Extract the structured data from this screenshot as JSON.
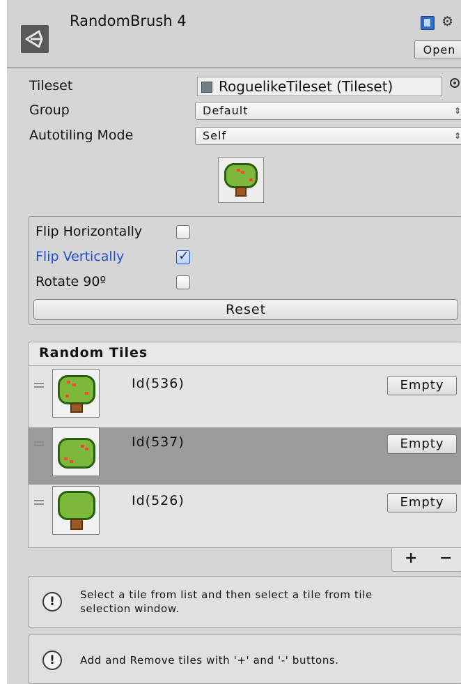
{
  "header": {
    "title": "RandomBrush 4",
    "open_label": "Open"
  },
  "properties": {
    "tileset_label": "Tileset",
    "tileset_value": "RoguelikeTileset (Tileset)",
    "group_label": "Group",
    "group_value": "Default",
    "autotiling_label": "Autotiling Mode",
    "autotiling_value": "Self"
  },
  "flip": {
    "horizontal_label": "Flip Horizontally",
    "horizontal_checked": false,
    "vertical_label": "Flip Vertically",
    "vertical_checked": true,
    "rotate_label": "Rotate 90º",
    "rotate_checked": false,
    "reset_label": "Reset"
  },
  "random_tiles": {
    "title": "Random Tiles",
    "rows": [
      {
        "id": "Id(536)",
        "empty_label": "Empty",
        "selected": false
      },
      {
        "id": "Id(537)",
        "empty_label": "Empty",
        "selected": true
      },
      {
        "id": "Id(526)",
        "empty_label": "Empty",
        "selected": false
      }
    ],
    "add_label": "+",
    "remove_label": "−"
  },
  "help": {
    "line1": "Select a tile from list and then select a tile from tile",
    "line2": "selection window.",
    "message2": "Add and Remove tiles with '+' and '-' buttons."
  },
  "colors": {
    "selected_row": "#9b9b9b",
    "flip_vertical_label": "#2450d6",
    "tree_leaves": "#7cb83a",
    "tree_trunk": "#9b5b22"
  }
}
